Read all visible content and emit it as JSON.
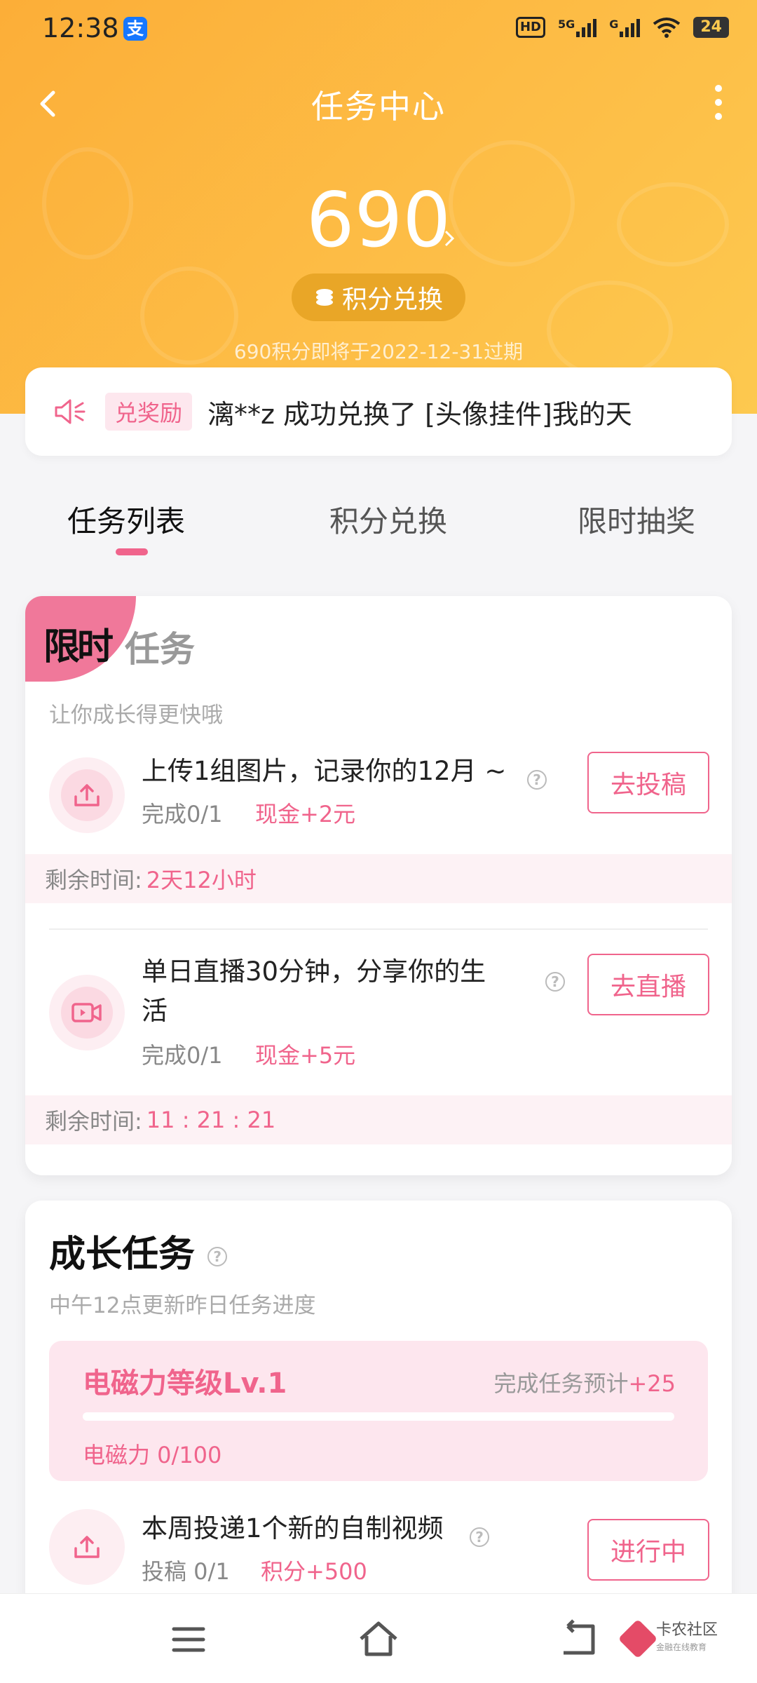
{
  "status_bar": {
    "time": "12:38",
    "app_icon": "支",
    "hd": "HD",
    "net1": "5G",
    "net2": "G",
    "battery": "24"
  },
  "nav": {
    "title": "任务中心"
  },
  "points": {
    "value": "690",
    "exchange_label": "积分兑换",
    "expire_text": "690积分即将于2022-12-31过期"
  },
  "notice": {
    "tag": "兑奖励",
    "text": "漓**z 成功兑换了 [头像挂件]我的天"
  },
  "tabs": [
    {
      "label": "任务列表",
      "active": true
    },
    {
      "label": "积分兑换",
      "active": false
    },
    {
      "label": "限时抽奖",
      "active": false
    }
  ],
  "limited": {
    "badge": "限时",
    "title": "任务",
    "subtitle": "让你成长得更快哦",
    "tasks": [
      {
        "icon": "upload-icon",
        "title": "上传1组图片，记录你的12月 ~",
        "progress": "完成0/1",
        "reward": "现金+2元",
        "button": "去投稿",
        "remain_label": "剩余时间:",
        "remain_value": "2天12小时"
      },
      {
        "icon": "video-camera-icon",
        "title_line1": "单日直播30分钟，分享你的生",
        "title_line2": "活",
        "progress": "完成0/1",
        "reward": "现金+5元",
        "button": "去直播",
        "remain_label": "剩余时间:",
        "remain_value": "11 : 21 : 21"
      }
    ]
  },
  "growth": {
    "title": "成长任务",
    "subtitle": "中午12点更新昨日任务进度",
    "level_name": "电磁力等级Lv.1",
    "level_hint": "完成任务预计",
    "level_hint_value": "+25",
    "level_progress": "电磁力 0/100",
    "level_fraction": 0.0,
    "task": {
      "icon": "upload-icon",
      "title": "本周投递1个新的自制视频",
      "progress": "投稿 0/1",
      "reward": "积分+500",
      "button": "进行中"
    }
  },
  "watermark": {
    "name": "卡农社区",
    "sub": "金融在线教育"
  },
  "colors": {
    "accent": "#f0648c",
    "hero_from": "#fcae38",
    "hero_to": "#fdc94f"
  }
}
